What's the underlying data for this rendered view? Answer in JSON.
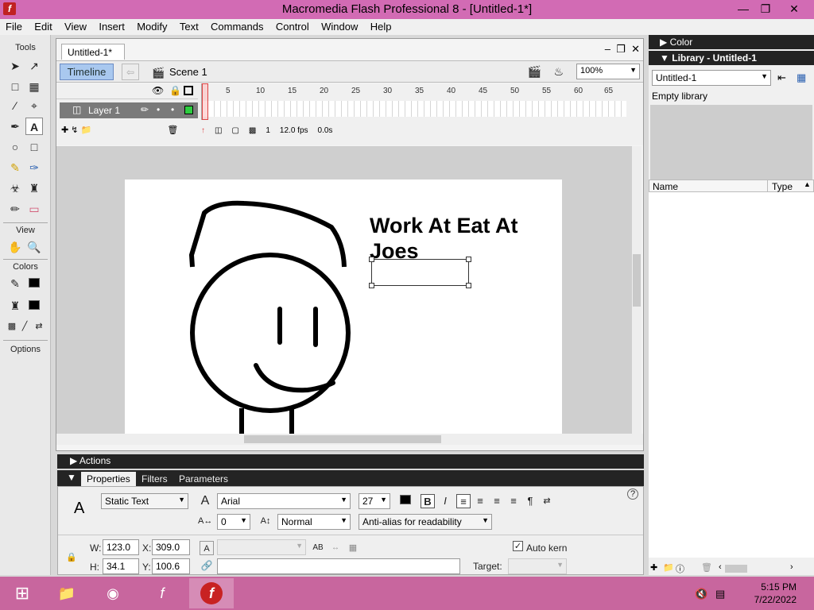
{
  "window": {
    "title": "Macromedia Flash Professional 8 - [Untitled-1*]"
  },
  "menu": [
    "File",
    "Edit",
    "View",
    "Insert",
    "Modify",
    "Text",
    "Commands",
    "Control",
    "Window",
    "Help"
  ],
  "tools": {
    "title": "Tools",
    "view_label": "View",
    "colors_label": "Colors",
    "options_label": "Options"
  },
  "document": {
    "tab": "Untitled-1*",
    "timeline_button": "Timeline",
    "scene": "Scene 1",
    "zoom": "100%",
    "layer_name": "Layer 1",
    "status": {
      "frame": "1",
      "fps": "12.0 fps",
      "time": "0.0s"
    },
    "stage_text": "Work At Eat At Joes"
  },
  "actions": {
    "label": "Actions"
  },
  "properties": {
    "tabs": [
      "Properties",
      "Filters",
      "Parameters"
    ],
    "text_type": "Static Text",
    "font": "Arial",
    "size": "27",
    "tracking": "0",
    "char_position": "Normal",
    "antialias": "Anti-alias for readability",
    "w_label": "W:",
    "w": "123.0",
    "x_label": "X:",
    "x": "309.0",
    "h_label": "H:",
    "h": "34.1",
    "y_label": "Y:",
    "y": "100.6",
    "autokern": "Auto kern",
    "target_label": "Target:"
  },
  "right_panel": {
    "color_header": "Color",
    "library_header": "Library - Untitled-1",
    "library_select": "Untitled-1",
    "empty": "Empty library",
    "col_name": "Name",
    "col_type": "Type"
  },
  "taskbar": {
    "time": "5:15 PM",
    "date": "7/22/2022"
  },
  "colors": {
    "titlebar": "#d26bb4",
    "taskbar": "#c8669e",
    "panel_header": "#232323",
    "timeline_button": "#a9c8ef"
  }
}
